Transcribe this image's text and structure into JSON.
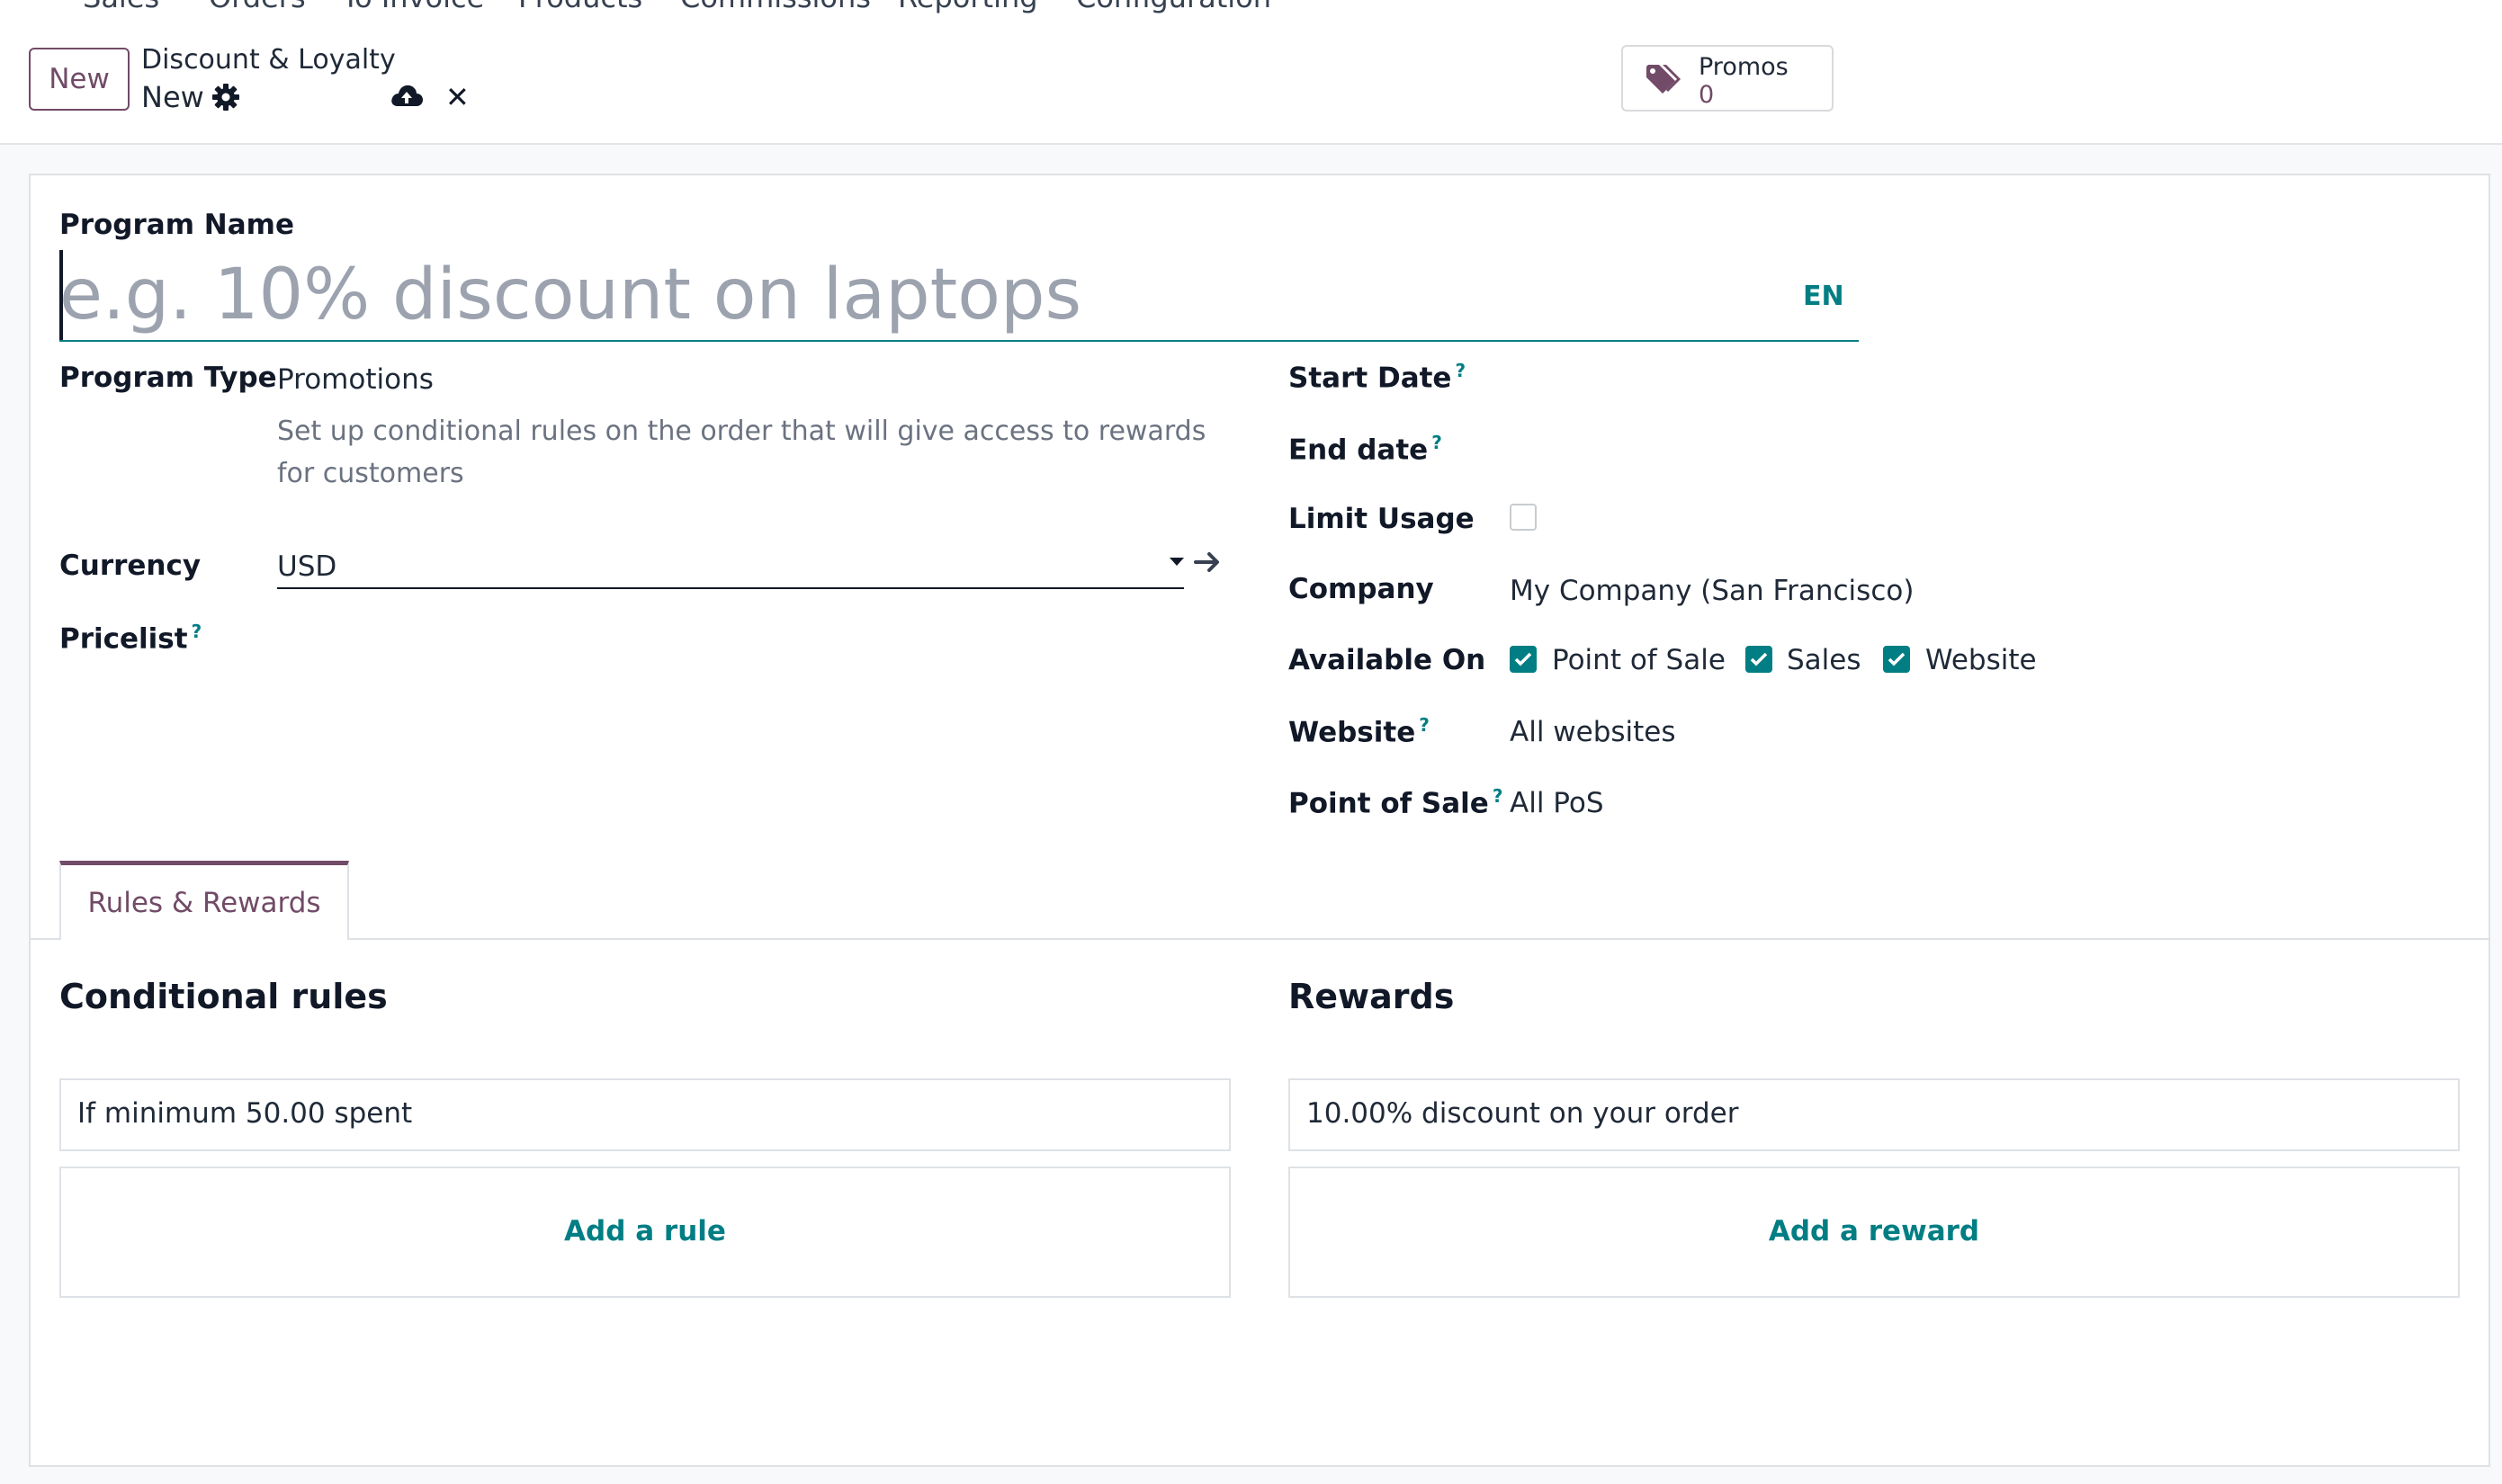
{
  "nav": {
    "app_name": "Sales",
    "items": [
      "Orders",
      "To Invoice",
      "Products",
      "Commissions",
      "Reporting",
      "Configuration"
    ]
  },
  "control_panel": {
    "new_button": "New",
    "breadcrumb_parent": "Discount & Loyalty",
    "breadcrumb_current": "New",
    "smart_button": {
      "label": "Promos",
      "count": "0"
    }
  },
  "form": {
    "program_name_label": "Program Name",
    "program_name_placeholder": "e.g. 10% discount on laptops",
    "program_name_value": "",
    "language": "EN",
    "program_type_label": "Program Type",
    "program_type_value": "Promotions",
    "program_type_description": "Set up conditional rules on the order that will give access to rewards for customers",
    "currency_label": "Currency",
    "currency_value": "USD",
    "pricelist_label": "Pricelist",
    "start_date_label": "Start Date",
    "end_date_label": "End date",
    "limit_usage_label": "Limit Usage",
    "limit_usage_checked": false,
    "company_label": "Company",
    "company_value": "My Company (San Francisco)",
    "available_on_label": "Available On",
    "available_on": [
      {
        "label": "Point of Sale",
        "checked": true
      },
      {
        "label": "Sales",
        "checked": true
      },
      {
        "label": "Website",
        "checked": true
      }
    ],
    "website_label": "Website",
    "website_placeholder": "All websites",
    "pos_label": "Point of Sale",
    "pos_placeholder": "All PoS",
    "help_mark": "?"
  },
  "tabs": [
    {
      "label": "Rules & Rewards",
      "active": true
    }
  ],
  "rules": {
    "title": "Conditional rules",
    "items": [
      "If minimum 50.00 spent"
    ],
    "add_label": "Add a rule"
  },
  "rewards": {
    "title": "Rewards",
    "items": [
      "10.00% discount on your order"
    ],
    "add_label": "Add a reward"
  },
  "colors": {
    "brand": "#714b67",
    "accent": "#017e84",
    "border": "#dee2e6"
  }
}
